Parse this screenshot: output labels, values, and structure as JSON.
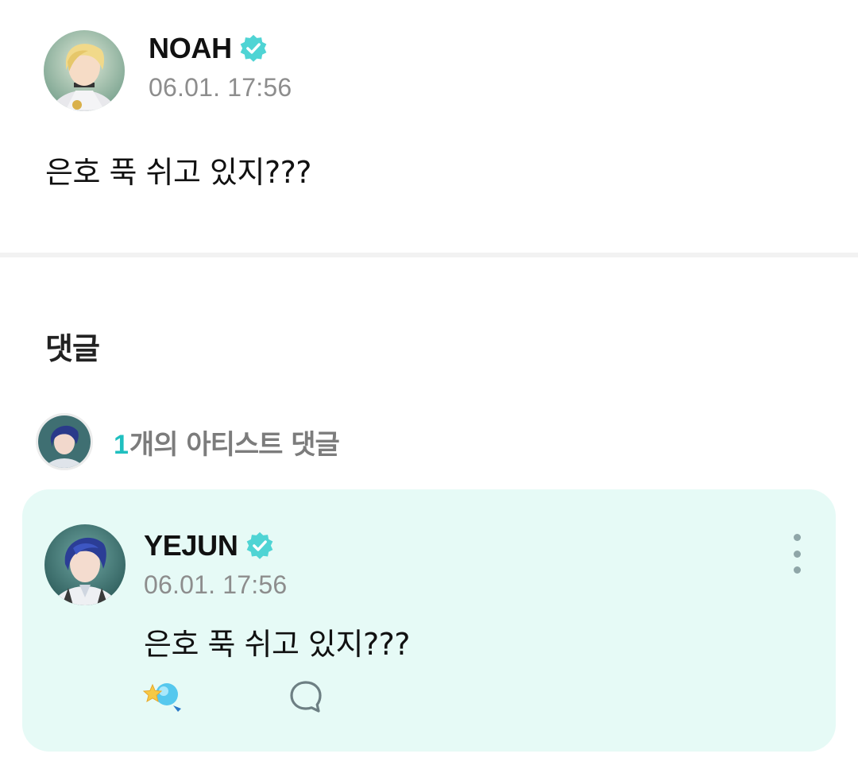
{
  "post": {
    "author": "NOAH",
    "time": "06.01. 17:56",
    "body": "은호 푹 쉬고 있지???"
  },
  "comments": {
    "title": "댓글",
    "artist_summary": {
      "count": "1",
      "label": "개의 아티스트 댓글"
    },
    "items": [
      {
        "author": "YEJUN",
        "time": "06.01. 17:56",
        "body": "은호 푹 쉬고 있지???"
      }
    ]
  },
  "icons": {
    "verified": "verified-badge-icon",
    "more": "more-vertical-icon",
    "like": "star-light-icon",
    "reply": "speech-bubble-icon"
  },
  "colors": {
    "accent": "#1fbfbf",
    "verified": "#4fd4d4",
    "card_background": "#e6faf6",
    "timestamp": "#8d8d8d"
  }
}
